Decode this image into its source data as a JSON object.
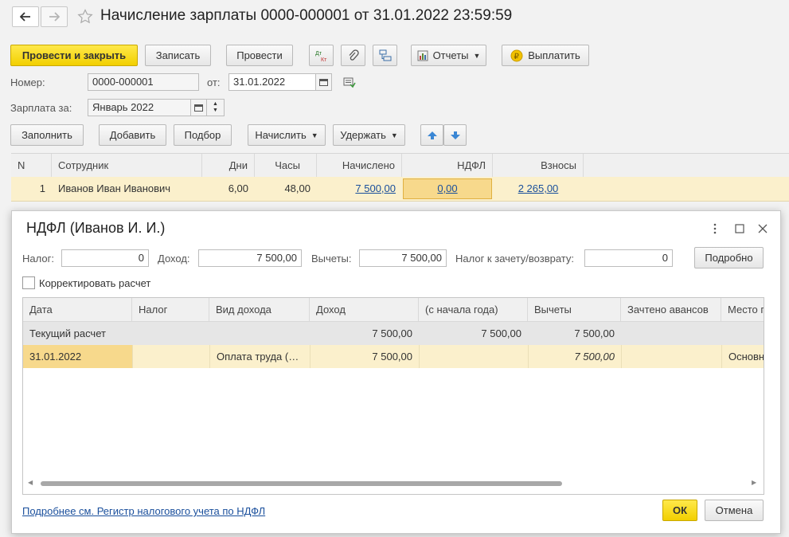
{
  "window": {
    "title": "Начисление зарплаты 0000-000001 от 31.01.2022 23:59:59"
  },
  "toolbar": {
    "post_close": "Провести и закрыть",
    "save": "Записать",
    "post": "Провести",
    "reports": "Отчеты",
    "pay": "Выплатить"
  },
  "form": {
    "number_label": "Номер:",
    "number_value": "0000-000001",
    "date_label": "от:",
    "date_value": "31.01.2022",
    "salary_label": "Зарплата за:",
    "salary_value": "Январь 2022"
  },
  "actions": {
    "fill": "Заполнить",
    "add": "Добавить",
    "pick": "Подбор",
    "accrue": "Начислить",
    "withhold": "Удержать"
  },
  "grid": {
    "headers": [
      "N",
      "Сотрудник",
      "Дни",
      "Часы",
      "Начислено",
      "НДФЛ",
      "Взносы"
    ],
    "rows": [
      {
        "n": "1",
        "employee": "Иванов Иван Иванович",
        "days": "6,00",
        "hours": "48,00",
        "accrued": "7 500,00",
        "ndfl": "0,00",
        "contributions": "2 265,00"
      }
    ]
  },
  "dialog": {
    "title": "НДФЛ (Иванов И. И.)",
    "tax_label": "Налог:",
    "tax_value": "0",
    "income_label": "Доход:",
    "income_value": "7 500,00",
    "deductions_label": "Вычеты:",
    "deductions_value": "7 500,00",
    "offset_label": "Налог к зачету/возврату:",
    "offset_value": "0",
    "details_button": "Подробно",
    "correct_label": "Корректировать расчет",
    "table": {
      "headers": [
        "Дата",
        "Налог",
        "Вид дохода",
        "Доход",
        "(с начала года)",
        "Вычеты",
        "Зачтено авансов",
        "Место п"
      ],
      "current_row": {
        "label": "Текущий расчет",
        "income": "7 500,00",
        "ytd": "7 500,00",
        "deductions": "7 500,00"
      },
      "row": {
        "date": "31.01.2022",
        "tax": "",
        "income_type": "Оплата труда (…",
        "income": "7 500,00",
        "ytd": "",
        "deductions": "7 500,00",
        "advances": "",
        "place": "Основн"
      }
    },
    "footer_link": "Подробнее см. Регистр налогового учета по НДФЛ",
    "ok": "ОК",
    "cancel": "Отмена"
  }
}
